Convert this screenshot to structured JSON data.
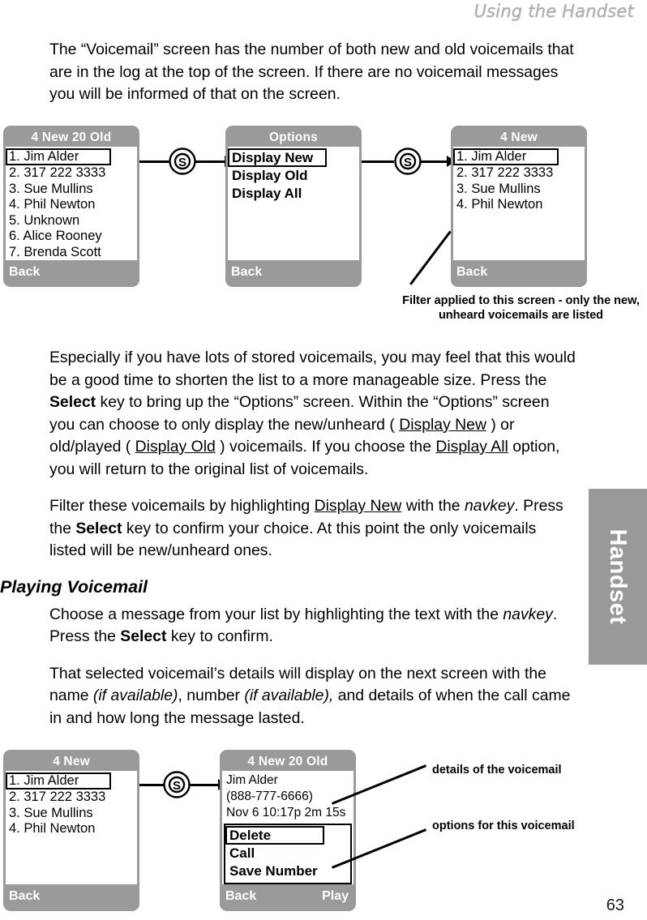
{
  "header": {
    "running_title": "Using the Handset"
  },
  "side_tab": {
    "label": "Handset"
  },
  "page_number": "63",
  "paragraphs": {
    "p1_a": "The “Voicemail” screen has the number of both new and old voicemails that are in the log at the top of the screen. If there are no voicemail messages you will be informed of that on the screen.",
    "p2_a": "Especially if you have lots of stored voicemails, you may feel that this would be a good time to shorten the list to a more manageable size. Press the ",
    "p2_select": "Select",
    "p2_b": " key to bring up the “Options” screen. Within the “Options” screen you can choose to only display the new/unheard ( ",
    "p2_display_new": "Display New",
    "p2_c": " ) or old/played ( ",
    "p2_display_old": "Display Old",
    "p2_d": " ) voicemails. If you choose the ",
    "p2_display_all": "Display All",
    "p2_e": " option, you will return to the original list of voicemails.",
    "p3_a": "Filter these voicemails by highlighting ",
    "p3_display_new": "Display New",
    "p3_b": " with the ",
    "p3_navkey": "navkey",
    "p3_c": ". Press the ",
    "p3_select": "Select",
    "p3_d": " key to confirm your choice. At this point the only voicemails listed will be new/unheard ones.",
    "p4_a": "Choose a message from your list by highlighting the text with the ",
    "p4_navkey": "navkey",
    "p4_b": ". Press the ",
    "p4_select": "Select",
    "p4_c": " key to confirm.",
    "p5_a": "That selected voicemail’s details will display on the next screen with the name ",
    "p5_if_avail_1": "(if available)",
    "p5_b": ", number ",
    "p5_if_avail_2": "(if available),",
    "p5_c": " and details of when the call came in and how long the message lasted."
  },
  "section_heading": "Playing Voicemail",
  "diagram_one": {
    "screen_a": {
      "title": "4 New 20 Old",
      "items": [
        "1. Jim Alder",
        "2. 317 222 3333",
        "3. Sue Mullins",
        "4. Phil Newton",
        "5. Unknown",
        "6. Alice Rooney",
        "7. Brenda Scott"
      ],
      "softkey_left": "Back",
      "softkey_right": ""
    },
    "screen_b": {
      "title": "Options",
      "items": [
        "Display New",
        "Display Old",
        "Display All"
      ],
      "softkey_left": "Back",
      "softkey_right": ""
    },
    "screen_c": {
      "title": "4 New",
      "items": [
        "1. Jim Alder",
        "2. 317 222 3333",
        "3. Sue Mullins",
        "4. Phil Newton"
      ],
      "softkey_left": "Back",
      "softkey_right": ""
    },
    "select_key_glyph": "S",
    "callout": "Filter applied to this screen - only the new, unheard voicemails are listed"
  },
  "diagram_two": {
    "screen_a": {
      "title": "4 New",
      "items": [
        "1. Jim Alder",
        "2. 317 222 3333",
        "3. Sue Mullins",
        "4. Phil Newton"
      ],
      "softkey_left": "Back",
      "softkey_right": ""
    },
    "screen_b": {
      "title": "4 New 20 Old",
      "detail": [
        "Jim Alder",
        "(888-777-6666)",
        "Nov 6   10:17p  2m 15s"
      ],
      "options": [
        "Delete",
        "Call",
        "Save Number"
      ],
      "softkey_left": "Back",
      "softkey_right": "Play"
    },
    "select_key_glyph": "S",
    "callout_details": "details of the voicemail",
    "callout_options": "options for this voicemail"
  },
  "colors": {
    "phone_grey": "#9a9a9a",
    "tab_grey": "#999999",
    "header_grey": "#b9b9b9"
  }
}
